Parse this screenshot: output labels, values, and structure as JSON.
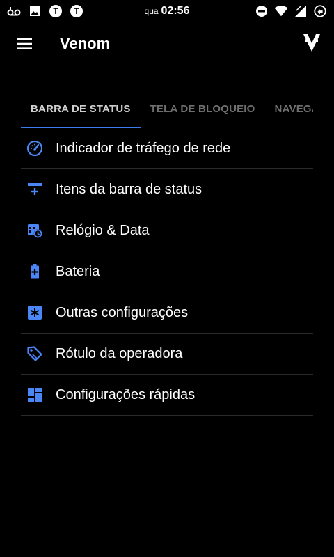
{
  "status_bar": {
    "day": "qua",
    "time": "02:56",
    "icons_left": [
      "voicemail-icon",
      "image-icon",
      "app-t-icon",
      "app-t-icon"
    ],
    "icons_right": [
      "do-not-disturb-icon",
      "wifi-icon",
      "signal-icon",
      "battery-icon"
    ]
  },
  "toolbar": {
    "title": "Venom",
    "menu_icon": "hamburger-menu-icon",
    "logo_icon": "venom-logo-icon"
  },
  "tabs": [
    {
      "label": "BARRA DE STATUS",
      "active": true
    },
    {
      "label": "TELA DE BLOQUEIO",
      "active": false
    },
    {
      "label": "NAVEGAÇ",
      "active": false
    }
  ],
  "list": [
    {
      "label": "Indicador de tráfego de rede",
      "icon": "speedometer-icon"
    },
    {
      "label": "Itens da barra de status",
      "icon": "status-bar-items-icon"
    },
    {
      "label": "Relógio & Data",
      "icon": "calendar-clock-icon"
    },
    {
      "label": "Bateria",
      "icon": "battery-plus-icon"
    },
    {
      "label": "Outras configurações",
      "icon": "asterisk-box-icon"
    },
    {
      "label": "Rótulo da operadora",
      "icon": "label-tag-icon"
    },
    {
      "label": "Configurações rápidas",
      "icon": "dashboard-tiles-icon"
    }
  ],
  "colors": {
    "background": "#000000",
    "accent": "#3d7bf0",
    "icon_blue": "#4a86f5",
    "tab_inactive": "#6f6f6f",
    "divider": "#2a2a2a"
  }
}
